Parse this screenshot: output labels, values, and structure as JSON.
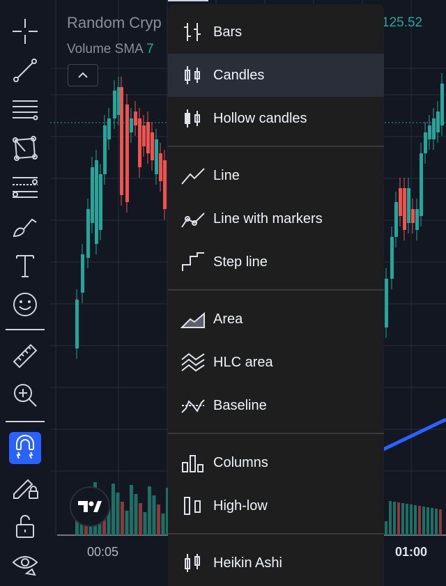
{
  "legend": {
    "title": "Random Cryp",
    "sma_label": "Volume SMA",
    "sma_value": "7",
    "last_price": "125.52"
  },
  "xaxis": {
    "labels": [
      "00:05",
      "01:00"
    ]
  },
  "toolbar": {
    "items": [
      {
        "name": "crosshair",
        "icon": "crosshair-icon"
      },
      {
        "name": "trend-line",
        "icon": "trend-line-icon"
      },
      {
        "name": "horizontal-lines",
        "icon": "horizontal-lines-icon"
      },
      {
        "name": "shapes",
        "icon": "polygon-icon"
      },
      {
        "name": "patterns",
        "icon": "fib-levels-icon"
      },
      {
        "name": "brush",
        "icon": "brush-icon"
      },
      {
        "name": "text",
        "icon": "text-icon"
      },
      {
        "name": "emoji",
        "icon": "smiley-icon"
      },
      {
        "name": "measure",
        "icon": "ruler-icon"
      },
      {
        "name": "zoom",
        "icon": "zoom-in-icon"
      },
      {
        "name": "magnet",
        "icon": "magnet-icon",
        "active": true
      },
      {
        "name": "lock-drawings",
        "icon": "pencil-lock-icon"
      },
      {
        "name": "lock",
        "icon": "unlock-icon"
      },
      {
        "name": "visibility",
        "icon": "eye-icon"
      }
    ]
  },
  "menu": {
    "items": [
      {
        "label": "Bars",
        "icon": "bars-icon",
        "selected": false
      },
      {
        "label": "Candles",
        "icon": "candles-icon",
        "selected": true
      },
      {
        "label": "Hollow candles",
        "icon": "hollow-candles-icon",
        "selected": false
      },
      {
        "label": "Line",
        "icon": "line-icon",
        "selected": false
      },
      {
        "label": "Line with markers",
        "icon": "line-markers-icon",
        "selected": false
      },
      {
        "label": "Step line",
        "icon": "step-line-icon",
        "selected": false
      },
      {
        "label": "Area",
        "icon": "area-icon",
        "selected": false
      },
      {
        "label": "HLC area",
        "icon": "hlc-area-icon",
        "selected": false
      },
      {
        "label": "Baseline",
        "icon": "baseline-icon",
        "selected": false
      },
      {
        "label": "Columns",
        "icon": "columns-icon",
        "selected": false
      },
      {
        "label": "High-low",
        "icon": "high-low-icon",
        "selected": false
      },
      {
        "label": "Heikin Ashi",
        "icon": "heikin-ashi-icon",
        "selected": false
      }
    ]
  },
  "colors": {
    "background": "#131722",
    "up": "#26a69a",
    "down": "#ef5350",
    "accent": "#2962ff",
    "menu_bg": "#1e1e1e"
  }
}
